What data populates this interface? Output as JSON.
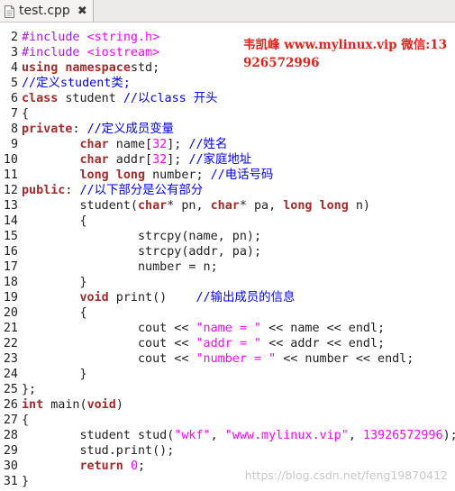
{
  "tab": {
    "title": "test.cpp",
    "close_symbol": "✖",
    "icon": "file-icon"
  },
  "watermark_top": "韦凯峰 www.mylinux.vip 微信:13926572996",
  "watermark_bottom": "https://blog.csdn.net/feng19870412",
  "lines": [
    {
      "n": "2",
      "t": [
        [
          "pp",
          "#include "
        ],
        [
          "str",
          "<string.h>"
        ]
      ]
    },
    {
      "n": "3",
      "t": [
        [
          "pp",
          "#include "
        ],
        [
          "str",
          "<iostream>"
        ]
      ]
    },
    {
      "n": "4",
      "t": [
        [
          "kw",
          "using namespace"
        ],
        [
          "",
          "std;"
        ]
      ]
    },
    {
      "n": "5",
      "t": [
        [
          "cm",
          "//定义student类;"
        ]
      ]
    },
    {
      "n": "6",
      "t": [
        [
          "kw",
          "class"
        ],
        [
          "",
          " student "
        ],
        [
          "cm",
          "//以class 开头"
        ]
      ]
    },
    {
      "n": "7",
      "t": [
        [
          "",
          "{"
        ]
      ]
    },
    {
      "n": "8",
      "t": [
        [
          "kw",
          "private"
        ],
        [
          "",
          ": "
        ],
        [
          "cm",
          "//定义成员变量"
        ]
      ]
    },
    {
      "n": "9",
      "t": [
        [
          "",
          "        "
        ],
        [
          "kw",
          "char"
        ],
        [
          "",
          " name["
        ],
        [
          "num",
          "32"
        ],
        [
          "",
          "]; "
        ],
        [
          "cm",
          "//姓名"
        ]
      ]
    },
    {
      "n": "10",
      "t": [
        [
          "",
          "        "
        ],
        [
          "kw",
          "char"
        ],
        [
          "",
          " addr["
        ],
        [
          "num",
          "32"
        ],
        [
          "",
          "]; "
        ],
        [
          "cm",
          "//家庭地址"
        ]
      ]
    },
    {
      "n": "11",
      "t": [
        [
          "",
          "        "
        ],
        [
          "kw",
          "long long"
        ],
        [
          "",
          " number; "
        ],
        [
          "cm",
          "//电话号码"
        ]
      ]
    },
    {
      "n": "12",
      "t": [
        [
          "kw",
          "public"
        ],
        [
          "",
          ": "
        ],
        [
          "cm",
          "//以下部分是公有部分"
        ]
      ]
    },
    {
      "n": "13",
      "t": [
        [
          "",
          "        student("
        ],
        [
          "kw",
          "char"
        ],
        [
          "",
          "* pn, "
        ],
        [
          "kw",
          "char"
        ],
        [
          "",
          "* pa, "
        ],
        [
          "kw",
          "long long"
        ],
        [
          "",
          " n)"
        ]
      ]
    },
    {
      "n": "14",
      "t": [
        [
          "",
          "        {"
        ]
      ]
    },
    {
      "n": "15",
      "t": [
        [
          "",
          "                strcpy(name, pn);"
        ]
      ]
    },
    {
      "n": "16",
      "t": [
        [
          "",
          "                strcpy(addr, pa);"
        ]
      ]
    },
    {
      "n": "17",
      "t": [
        [
          "",
          "                number = n;"
        ]
      ]
    },
    {
      "n": "18",
      "t": [
        [
          "",
          "        }"
        ]
      ]
    },
    {
      "n": "19",
      "t": [
        [
          "",
          "        "
        ],
        [
          "kw",
          "void"
        ],
        [
          "",
          " print()    "
        ],
        [
          "cm",
          "//输出成员的信息"
        ]
      ]
    },
    {
      "n": "20",
      "t": [
        [
          "",
          "        {"
        ]
      ]
    },
    {
      "n": "21",
      "t": [
        [
          "",
          "                cout << "
        ],
        [
          "str",
          "\"name = \""
        ],
        [
          "",
          " << name << endl;"
        ]
      ]
    },
    {
      "n": "22",
      "t": [
        [
          "",
          "                cout << "
        ],
        [
          "str",
          "\"addr = \""
        ],
        [
          "",
          " << addr << endl;"
        ]
      ]
    },
    {
      "n": "23",
      "t": [
        [
          "",
          "                cout << "
        ],
        [
          "str",
          "\"number = \""
        ],
        [
          "",
          " << number << endl;"
        ]
      ]
    },
    {
      "n": "24",
      "t": [
        [
          "",
          "        }"
        ]
      ]
    },
    {
      "n": "25",
      "t": [
        [
          "",
          "};"
        ]
      ]
    },
    {
      "n": "26",
      "t": [
        [
          "kw",
          "int"
        ],
        [
          "",
          " main("
        ],
        [
          "kw",
          "void"
        ],
        [
          "",
          ")"
        ]
      ]
    },
    {
      "n": "27",
      "t": [
        [
          "",
          "{"
        ]
      ]
    },
    {
      "n": "28",
      "t": [
        [
          "",
          "        student stud("
        ],
        [
          "str",
          "\"wkf\""
        ],
        [
          "",
          ", "
        ],
        [
          "str",
          "\"www.mylinux.vip\""
        ],
        [
          "",
          ", "
        ],
        [
          "num",
          "13926572996"
        ],
        [
          "",
          ");"
        ]
      ]
    },
    {
      "n": "29",
      "t": [
        [
          "",
          "        stud.print();"
        ]
      ]
    },
    {
      "n": "30",
      "t": [
        [
          "",
          "        "
        ],
        [
          "kw",
          "return"
        ],
        [
          "",
          " "
        ],
        [
          "num",
          "0"
        ],
        [
          "",
          ";"
        ]
      ]
    },
    {
      "n": "31",
      "t": [
        [
          "",
          "}"
        ]
      ]
    }
  ]
}
